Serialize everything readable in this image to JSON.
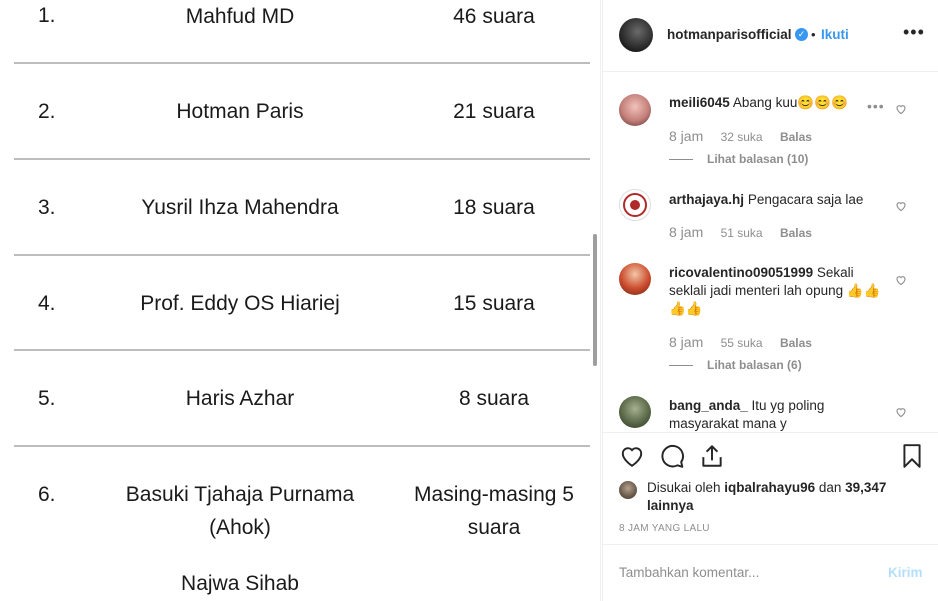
{
  "poll": [
    {
      "rank": "1.",
      "name_lines": [
        "Mahfud MD"
      ],
      "votes_lines": [
        "46 suara"
      ]
    },
    {
      "rank": "2.",
      "name_lines": [
        "Hotman Paris"
      ],
      "votes_lines": [
        "21 suara"
      ]
    },
    {
      "rank": "3.",
      "name_lines": [
        "Yusril Ihza Mahendra"
      ],
      "votes_lines": [
        "18 suara"
      ]
    },
    {
      "rank": "4.",
      "name_lines": [
        "Prof. Eddy OS Hiariej"
      ],
      "votes_lines": [
        "15 suara"
      ]
    },
    {
      "rank": "5.",
      "name_lines": [
        "Haris Azhar"
      ],
      "votes_lines": [
        "8 suara"
      ]
    },
    {
      "rank": "6.",
      "name_lines": [
        "Basuki Tjahaja Purnama",
        "(Ahok)",
        "Najwa Sihab"
      ],
      "votes_lines": [
        "Masing-masing 5",
        "suara"
      ]
    }
  ],
  "header": {
    "username": "hotmanparisofficial",
    "verified_icon": "check",
    "dot": "•",
    "follow_label": "Ikuti",
    "more_label": "•••"
  },
  "comments": [
    {
      "user": "meili6045",
      "text": "Abang kuu😊😊😊",
      "time": "8 jam",
      "likes": "32 suka",
      "reply": "Balas",
      "replies": "Lihat balasan (10)",
      "more": "•••",
      "avatar_color": "#c47f7a"
    },
    {
      "user": "arthajaya.hj",
      "text": "Pengacara saja lae",
      "time": "8 jam",
      "likes": "51 suka",
      "reply": "Balas",
      "replies": "",
      "avatar_color": "#b12a2a"
    },
    {
      "user": "ricovalentino09051999",
      "text": "Sekali seklali jadi menteri lah opung 👍👍👍👍",
      "time": "8 jam",
      "likes": "55 suka",
      "reply": "Balas",
      "replies": "Lihat balasan (6)",
      "avatar_color": "#cc4b2d"
    },
    {
      "user": "bang_anda_",
      "text": "Itu yg poling masyarakat mana y",
      "time": "",
      "likes": "",
      "reply": "",
      "replies": "",
      "avatar_color": "#5c6a4a"
    }
  ],
  "liked": {
    "prefix": "Disukai oleh ",
    "user": "iqbalrahayu96",
    "mid": " dan ",
    "count": "39,347 lainnya"
  },
  "time_ago": "8 JAM YANG LALU",
  "comment_box": {
    "placeholder": "Tambahkan komentar...",
    "post_label": "Kirim"
  },
  "colors": {
    "accent": "#3897f0",
    "text": "#262626",
    "muted": "#8e8e8e",
    "post_disabled": "#b2dffc"
  }
}
